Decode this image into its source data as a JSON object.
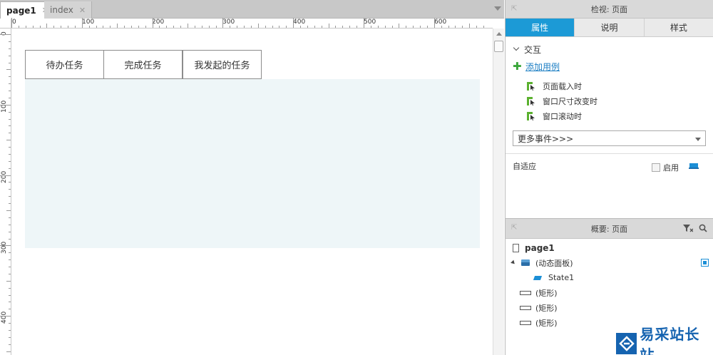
{
  "tabs": [
    {
      "label": "page1",
      "active": true
    },
    {
      "label": "index",
      "active": false
    }
  ],
  "close_glyph": "✕",
  "ruler": {
    "top_labels": [
      "0",
      "100",
      "200",
      "300",
      "400",
      "500",
      "600"
    ],
    "left_labels": [
      "0",
      "100",
      "200",
      "300",
      "400"
    ]
  },
  "canvas": {
    "nav_buttons": [
      "待办任务",
      "完成任务",
      "我发起的任务"
    ],
    "panel_color": "#eef6f8"
  },
  "inspector": {
    "title": "检视: 页面",
    "tabs": [
      "属性",
      "说明",
      "样式"
    ],
    "active_tab": "属性",
    "interaction_title": "交互",
    "add_case": "添加用例",
    "events": [
      "页面载入时",
      "窗口尺寸改变时",
      "窗口滚动时"
    ],
    "more_events": "更多事件>>>",
    "adaptive_label": "自适应",
    "enable_label": "启用"
  },
  "outline": {
    "title": "概要: 页面",
    "page_name": "page1",
    "dynamic_panel": "(动态面板)",
    "state": "State1",
    "rects": [
      "(矩形)",
      "(矩形)",
      "(矩形)"
    ]
  },
  "watermark": {
    "text": "易采站长站"
  },
  "colors": {
    "accent": "#1c9ad6",
    "link": "#1d7fc4",
    "add_icon": "#3aa63a",
    "event_icon": "#5bb12f"
  }
}
